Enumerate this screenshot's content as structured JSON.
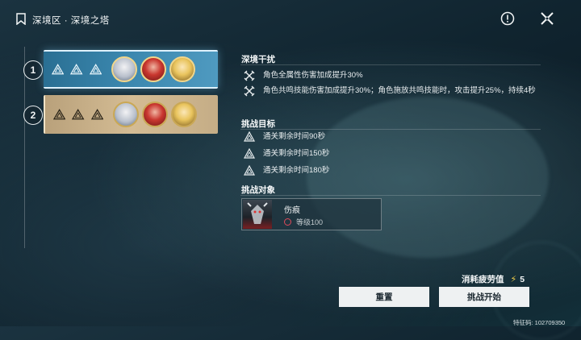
{
  "header": {
    "breadcrumb": "深境区 · 深境之塔",
    "info_icon": "alert-circle-icon",
    "close_icon": "close-x-icon"
  },
  "levels": [
    {
      "number": "1",
      "selected": true
    },
    {
      "number": "2",
      "selected": false
    }
  ],
  "interference": {
    "title": "深境干扰",
    "items": [
      "角色全属性伤害加成提升30%",
      "角色共鸣技能伤害加成提升30%；角色施放共鸣技能时，攻击提升25%，持续4秒"
    ]
  },
  "goals": {
    "title": "挑战目标",
    "items": [
      "通关剩余时间90秒",
      "通关剩余时间150秒",
      "通关剩余时间180秒"
    ]
  },
  "target": {
    "title": "挑战对象",
    "name": "伤痕",
    "level": "等级100"
  },
  "cost": {
    "label": "消耗疲劳值",
    "value": "5"
  },
  "buttons": {
    "reset": "重置",
    "start": "挑战开始"
  },
  "footer": {
    "code": "特征码: 102709350"
  },
  "colors": {
    "selected_card": "#3a86ad",
    "unselected_card": "#d4bc94",
    "button_bg": "#eef1f2",
    "bolt": "#f5d04a"
  }
}
